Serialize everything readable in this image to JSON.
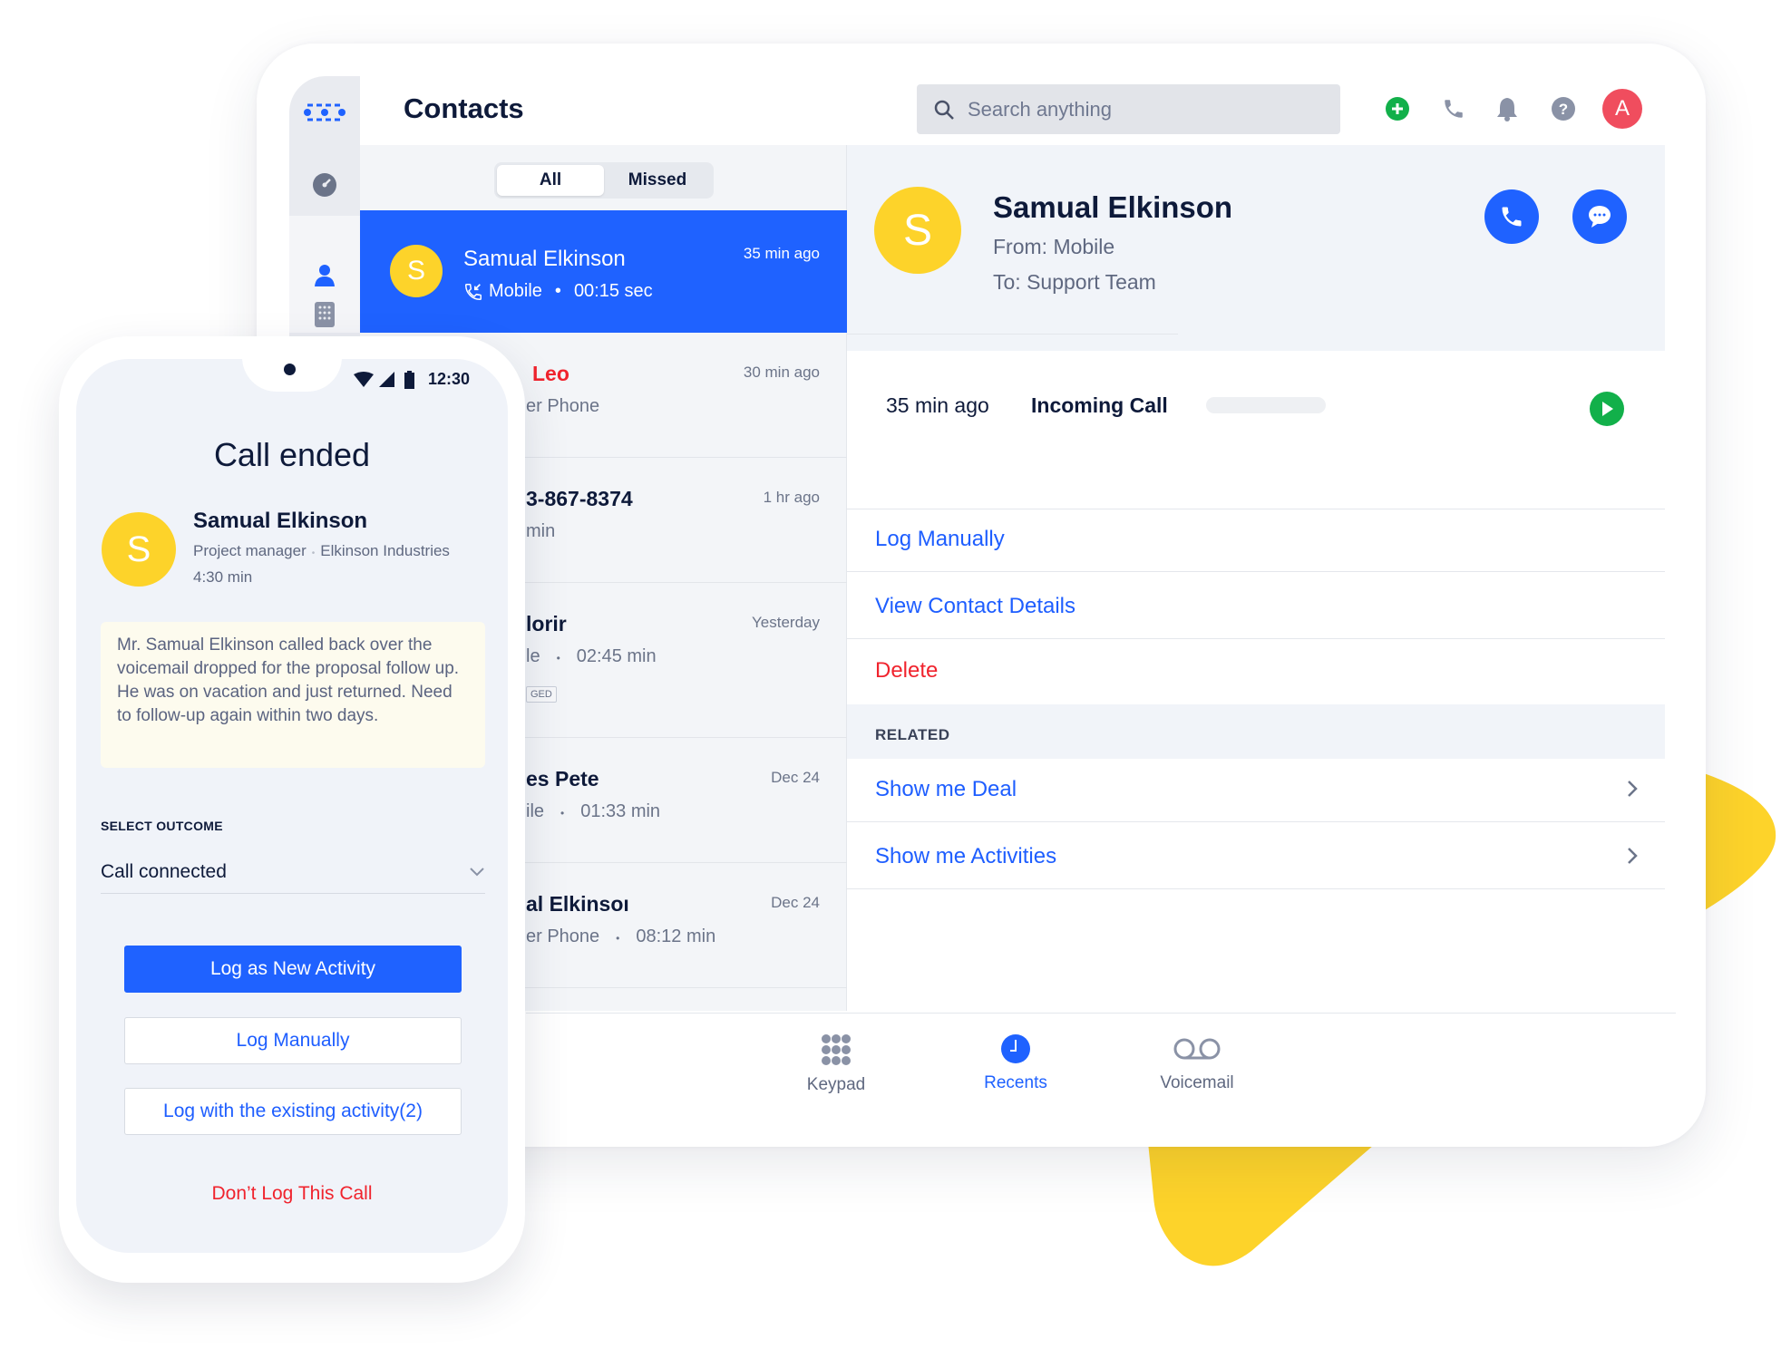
{
  "colors": {
    "accent": "#1f62ff",
    "danger": "#f0232d",
    "avatar": "#fdd32a",
    "success": "#12b04a",
    "user_avatar": "#f04d5e"
  },
  "header": {
    "title": "Contacts",
    "search_placeholder": "Search anything",
    "user_initial": "A",
    "icons": [
      "add-icon",
      "phone-icon",
      "bell-icon",
      "help-icon"
    ]
  },
  "sidebar": {
    "items": [
      "logo-icon",
      "dashboard-icon",
      "contacts-icon",
      "keypad-icon"
    ],
    "active": "contacts-icon"
  },
  "list": {
    "tabs": [
      {
        "label": "All",
        "active": true
      },
      {
        "label": "Missed",
        "active": false
      }
    ],
    "selected": {
      "initial": "S",
      "name": "Samual Elkinson",
      "source": "Mobile",
      "duration": "00:15 sec",
      "time": "35 min ago"
    },
    "rows": [
      {
        "name": "Leo",
        "sub": "er Phone",
        "time": "30 min ago",
        "missed": true
      },
      {
        "name": "3-867-8374",
        "sub": "min",
        "time": "1 hr ago"
      },
      {
        "name": "lorir",
        "sub": "le",
        "duration": "02:45 min",
        "time": "Yesterday",
        "tag": "GED"
      },
      {
        "name": "es Pete",
        "sub": "ile",
        "duration": "01:33 min",
        "time": "Dec 24"
      },
      {
        "name": "al Elkinsoı",
        "sub": "er Phone",
        "duration": "08:12 min",
        "time": "Dec 24"
      }
    ]
  },
  "detail": {
    "initial": "S",
    "name": "Samual Elkinson",
    "from": "From: Mobile",
    "to": "To: Support Team",
    "call": {
      "time": "35 min ago",
      "type": "Incoming Call"
    },
    "actions": {
      "log_manually": "Log Manually",
      "view_contact": "View Contact Details",
      "delete": "Delete"
    },
    "related": {
      "title": "RELATED",
      "items": [
        "Show me Deal",
        "Show me Activities"
      ]
    }
  },
  "bottom_nav": [
    {
      "label": "Keypad",
      "icon": "keypad-icon"
    },
    {
      "label": "Recents",
      "icon": "clock-icon",
      "active": true
    },
    {
      "label": "Voicemail",
      "icon": "voicemail-icon"
    }
  ],
  "phone": {
    "status_time": "12:30",
    "title": "Call ended",
    "contact": {
      "initial": "S",
      "name": "Samual Elkinson",
      "role": "Project manager",
      "company": "Elkinson Industries",
      "duration": "4:30 min"
    },
    "note": "Mr. Samual Elkinson called back over the voicemail dropped for the proposal follow up. He was on vacation and just returned. Need to follow-up again within two days.",
    "outcome_label": "SELECT OUTCOME",
    "outcome_value": "Call connected",
    "buttons": {
      "new_activity": "Log as New Activity",
      "log_manually": "Log Manually",
      "existing": "Log with the existing activity(2)",
      "dont_log": "Don’t Log This Call"
    }
  }
}
